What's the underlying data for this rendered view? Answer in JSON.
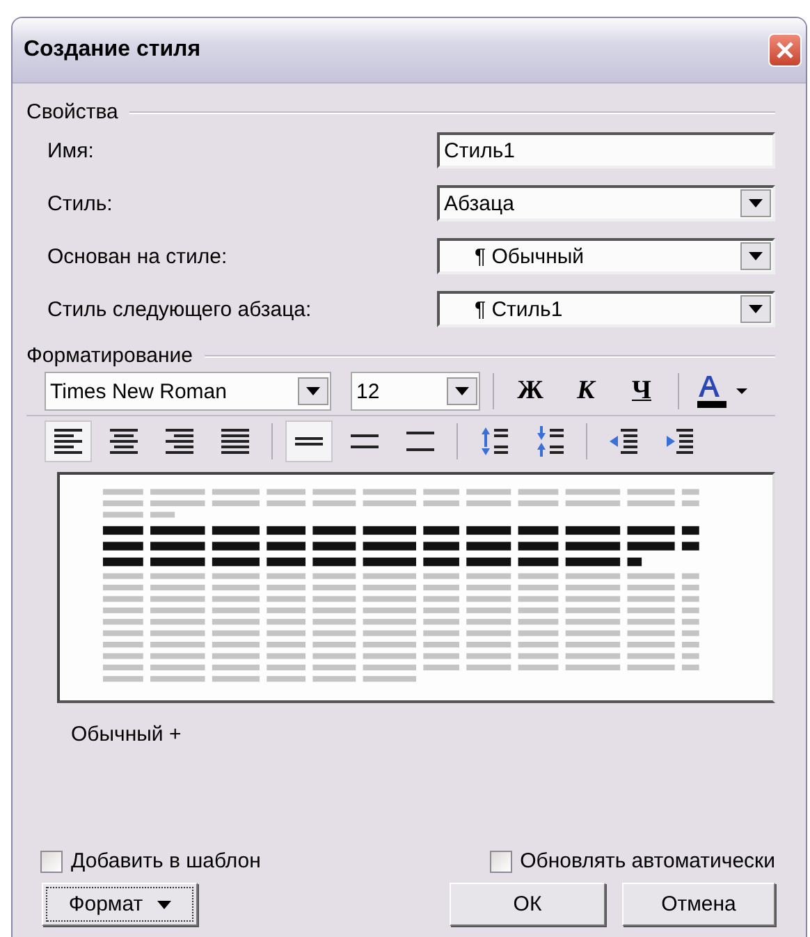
{
  "window": {
    "title": "Создание стиля"
  },
  "properties": {
    "label": "Свойства",
    "fields": [
      {
        "label": "Имя:",
        "kind": "text",
        "value": "Стиль1"
      },
      {
        "label": "Стиль:",
        "kind": "dropdown",
        "value": "Абзаца"
      },
      {
        "label": "Основан на стиле:",
        "kind": "dropdown",
        "value": "¶ Обычный"
      },
      {
        "label": "Стиль следующего абзаца:",
        "kind": "dropdown",
        "value": "¶ Стиль1"
      }
    ]
  },
  "formatting": {
    "label": "Форматирование",
    "font": "Times New Roman",
    "size": "12",
    "style_buttons": [
      {
        "kind": "bold",
        "label": "Ж"
      },
      {
        "kind": "italic",
        "label": "К"
      },
      {
        "kind": "underline",
        "label": "Ч"
      }
    ],
    "alignment": [
      {
        "kind": "left",
        "selected": true
      },
      {
        "kind": "center",
        "selected": false
      },
      {
        "kind": "right",
        "selected": false
      },
      {
        "kind": "justify",
        "selected": false
      }
    ],
    "line_spacing": [
      {
        "kind": "single",
        "selected": true
      },
      {
        "kind": "one-half",
        "selected": false
      },
      {
        "kind": "double",
        "selected": false
      }
    ]
  },
  "description": "Обычный +",
  "checkboxes": [
    {
      "label": "Добавить в шаблон",
      "checked": false
    },
    {
      "label": "Обновлять автоматически",
      "checked": false
    }
  ],
  "buttons": {
    "format": "Формат",
    "ok": "ОК",
    "cancel": "Отмена"
  }
}
